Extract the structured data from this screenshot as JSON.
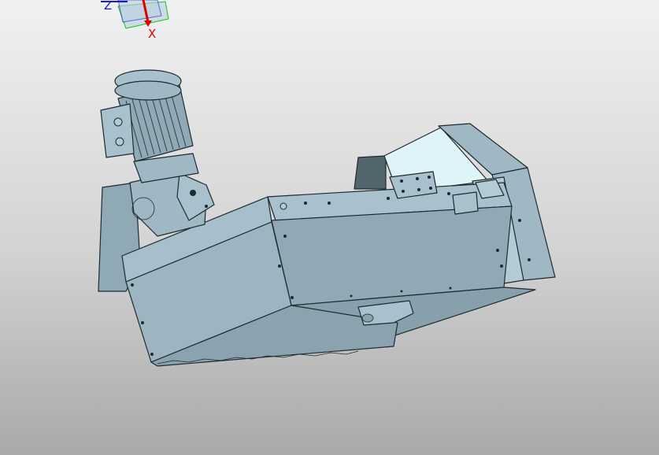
{
  "viewer": {
    "triad": {
      "x_label": "X",
      "z_label": "Z",
      "x_color": "#e00000",
      "z_color": "#1a1ad0",
      "y_color": "#00c000"
    },
    "model": {
      "icon": "cad-assembly-icon",
      "body_color": "#9fb8c4",
      "body_dark": "#7f9aa6",
      "edge_color": "#1e2a30",
      "highlight_color": "#dff4f8"
    }
  }
}
